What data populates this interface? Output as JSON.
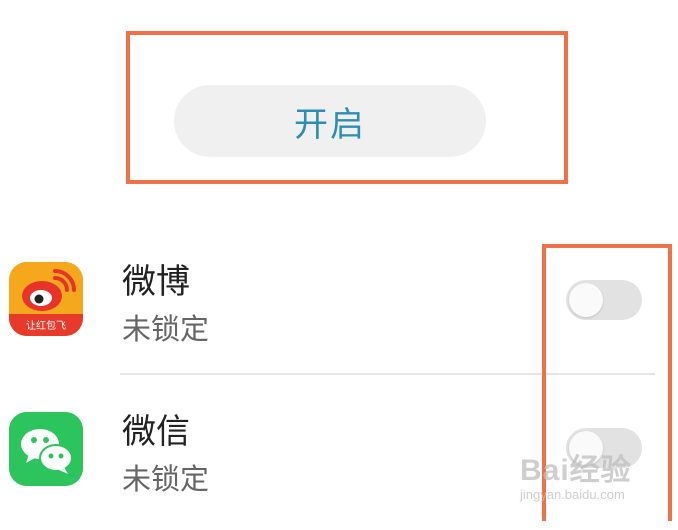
{
  "enable_button": {
    "label": "开启"
  },
  "apps": [
    {
      "name": "微博",
      "status": "未锁定",
      "icon": "weibo-icon",
      "icon_text": "让红包飞",
      "enabled": false
    },
    {
      "name": "微信",
      "status": "未锁定",
      "icon": "wechat-icon",
      "enabled": false
    }
  ],
  "watermark": {
    "main": "Bai经验",
    "sub": "jingyan.baidu.com"
  },
  "colors": {
    "annotation": "#f07048",
    "button_text": "#2a8fb3",
    "button_bg": "#f0f0f0",
    "toggle_off": "#e2e2e2",
    "weibo": "#f6a81c",
    "wechat": "#2cc55d"
  }
}
